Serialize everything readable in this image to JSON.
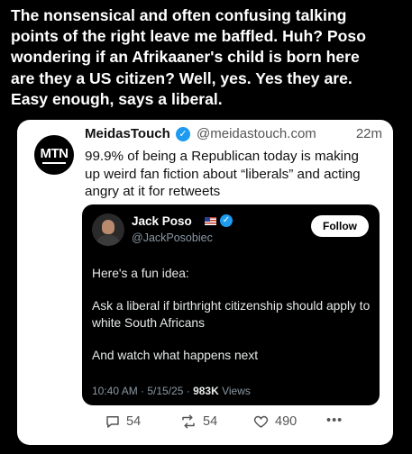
{
  "caption": {
    "lines": [
      "The nonsensical and often confusing talking",
      "points of the right leave me baffled. Huh? Poso",
      "wondering if an Afrikaaner's child is born here",
      "are they a US citizen? Well, yes. Yes they are.",
      "Easy enough, says a liberal."
    ]
  },
  "tweet": {
    "avatar_text": "MTN",
    "name": "MeidasTouch",
    "verified_icon": "verified-badge-icon",
    "handle": "@meidastouch.com",
    "time": "22m",
    "text_lines": [
      "99.9% of being a Republican today is making",
      "up weird fan fiction about “liberals” and acting",
      "angry at it for retweets"
    ],
    "replies": "54",
    "reposts": "54",
    "likes": "490",
    "more_label": "•••"
  },
  "quote": {
    "name": "Jack Poso",
    "handle": "@JackPosobiec",
    "follow_label": "Follow",
    "paragraphs": [
      "Here's a fun idea:",
      "Ask a liberal if birthright citizenship should apply to white South Africans",
      "And watch what happens next"
    ],
    "meta_prefix": "10:40 AM · 5/15/25 · ",
    "views_count": "983K",
    "views_suffix": " Views"
  },
  "colors": {
    "background": "#000000",
    "card": "#ffffff",
    "verified": "#1d9bf0",
    "quote_background": "#000000"
  }
}
